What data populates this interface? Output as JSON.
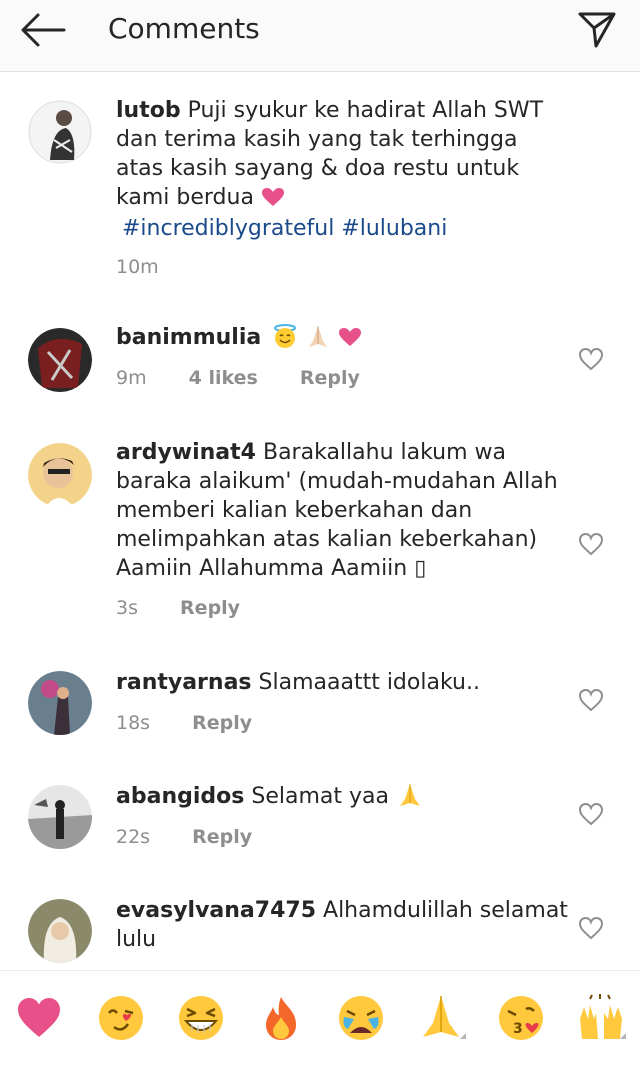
{
  "header": {
    "title": "Comments",
    "back_icon": "arrow-left-icon",
    "send_icon": "paper-plane-icon"
  },
  "caption": {
    "username": "lutob",
    "text": "Puji syukur ke hadirat Allah SWT dan terima kasih yang tak terhingga atas kasih sayang & doa restu untuk kami berdua",
    "emoji": "heart",
    "hashtags": "#incrediblygrateful #lulubani",
    "time": "10m"
  },
  "comments": [
    {
      "username": "banimmulia",
      "text": "",
      "emojis": [
        "smiling-face-with-halo",
        "folded-hands",
        "heart"
      ],
      "time": "9m",
      "likes": "4 likes",
      "reply": "Reply"
    },
    {
      "username": "ardywinat4",
      "text": "Barakallahu lakum wa baraka alaikum' (mudah-mudahan Allah memberi kalian keberkahan dan melimpahkan atas kalian keberkahan) Aamiin Allahumma Aamiin",
      "trailing": "▯",
      "time": "3s",
      "reply": "Reply"
    },
    {
      "username": "rantyarnas",
      "text": "Slamaaattt idolaku..",
      "time": "18s",
      "reply": "Reply"
    },
    {
      "username": "abangidos",
      "text": "Selamat yaa",
      "emojis": [
        "folded-hands"
      ],
      "time": "22s",
      "reply": "Reply"
    },
    {
      "username": "evasylvana7475",
      "text": "Alhamdulillah selamat lulu",
      "time": "",
      "reply": ""
    }
  ],
  "emoji_bar": [
    "heart",
    "face-blowing-kiss-wink",
    "grinning-squinting-face",
    "fire",
    "crying-face",
    "folded-hands",
    "kissing-face-with-heart",
    "raising-hands"
  ],
  "colors": {
    "accent_text": "#1a4a8a",
    "muted": "#8e8e8e",
    "heart": "#e8508a",
    "emoji_yellow": "#ffcc33"
  }
}
